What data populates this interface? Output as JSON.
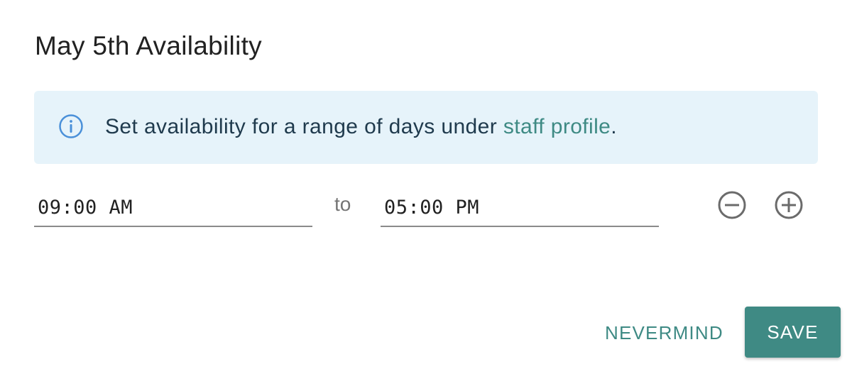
{
  "dialog": {
    "title": "May 5th Availability"
  },
  "info": {
    "icon": "info-icon",
    "text_before": "Set availability for a range of days under ",
    "link_text": "staff profile",
    "text_after": "."
  },
  "time_range": {
    "start_value": "09:00 AM",
    "separator": "to",
    "end_value": "05:00 PM",
    "remove_icon": "minus-circle-icon",
    "add_icon": "plus-circle-icon"
  },
  "actions": {
    "cancel_label": "NEVERMIND",
    "save_label": "SAVE"
  },
  "colors": {
    "accent": "#3f8a84",
    "info_background": "#e6f3fa",
    "info_icon": "#4a90d9",
    "title_text": "#212121",
    "control_icon": "#6b6b6b"
  }
}
